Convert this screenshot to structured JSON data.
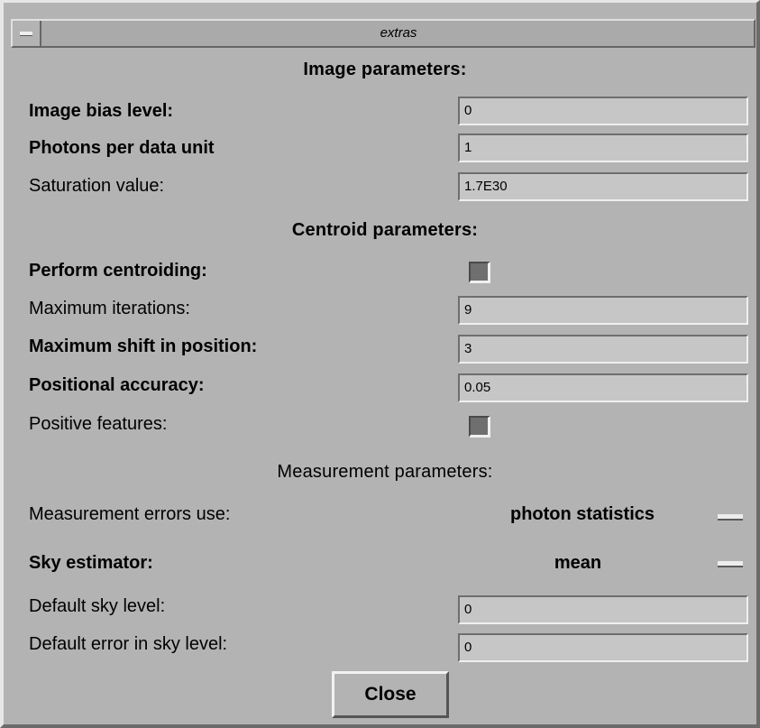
{
  "window": {
    "title": "extras"
  },
  "image_section": {
    "heading": "Image parameters:",
    "bias_label": "Image bias level:",
    "bias_value": "0",
    "photons_label": "Photons per data unit",
    "photons_value": "1",
    "saturation_label": "Saturation value:",
    "saturation_value": "1.7E30"
  },
  "centroid_section": {
    "heading": "Centroid parameters:",
    "perform_label": "Perform centroiding:",
    "perform_checked": true,
    "iterations_label": "Maximum iterations:",
    "iterations_value": "9",
    "shift_label": "Maximum shift in position:",
    "shift_value": "3",
    "accuracy_label": "Positional accuracy:",
    "accuracy_value": "0.05",
    "positive_label": "Positive features:",
    "positive_checked": true
  },
  "measurement_section": {
    "heading": "Measurement parameters:",
    "errors_label": "Measurement errors use:",
    "errors_value": "photon statistics",
    "sky_estimator_label": "Sky estimator:",
    "sky_estimator_value": "mean",
    "sky_level_label": "Default sky level:",
    "sky_level_value": "0",
    "sky_error_label": "Default error in sky level:",
    "sky_error_value": "0"
  },
  "buttons": {
    "close_label": "Close"
  }
}
